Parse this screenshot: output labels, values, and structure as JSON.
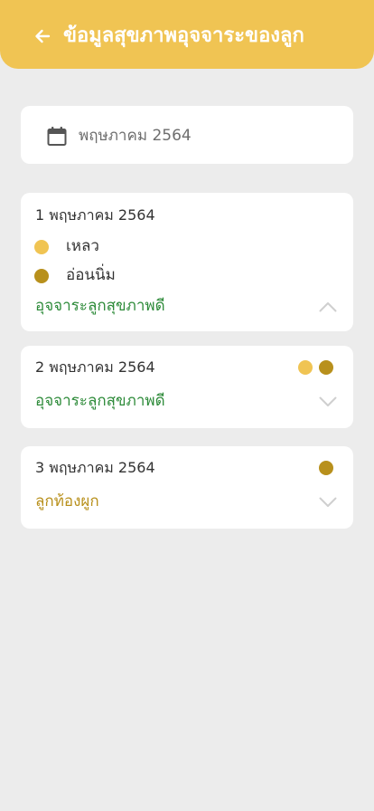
{
  "header": {
    "title": "ข้อมูลสุขภาพอุจจาระของลูก",
    "bg_color": "#f0c453"
  },
  "date_picker": {
    "value": "พฤษภาคม 2564"
  },
  "colors": {
    "yellow": "#f0c453",
    "brown": "#b8901c",
    "good_status": "#2e8b3a",
    "bad_status": "#b8901c"
  },
  "entries": [
    {
      "date": "1 พฤษภาคม 2564",
      "expanded": true,
      "details": [
        {
          "color": "yellow",
          "label": "เหลว"
        },
        {
          "color": "brown",
          "label": "อ่อนนิ่ม"
        }
      ],
      "status": "อุจจาระลูกสุขภาพดี"
    },
    {
      "date": "2 พฤษภาคม 2564",
      "expanded": false,
      "dots": [
        "yellow",
        "brown"
      ],
      "status": "อุจจาระลูกสุขภาพดี"
    },
    {
      "date": "3 พฤษภาคม 2564",
      "expanded": false,
      "dots": [
        "brown"
      ],
      "status": "ลูกท้องผูก"
    }
  ]
}
